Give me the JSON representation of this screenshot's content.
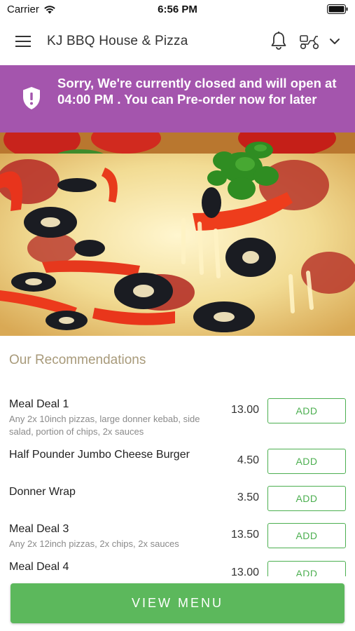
{
  "status_bar": {
    "carrier": "Carrier",
    "time": "6:56 PM"
  },
  "header": {
    "title": "KJ BBQ House & Pizza",
    "icons": [
      "menu-icon",
      "bell-icon",
      "scooter-icon",
      "chevron-down-icon"
    ]
  },
  "banner": {
    "message": "Sorry, We're currently closed and will open at 04:00 PM . You can Pre-order now for later",
    "color": "#a455ad",
    "icon": "shield-icon"
  },
  "recommendations": {
    "title": "Our Recommendations",
    "add_label": "ADD",
    "items": [
      {
        "name": "Meal Deal 1",
        "description": "Any 2x 10inch pizzas, large donner kebab, side salad, portion of chips, 2x sauces",
        "price": "13.00"
      },
      {
        "name": "Half Pounder Jumbo Cheese Burger",
        "description": "",
        "price": "4.50"
      },
      {
        "name": "Donner Wrap",
        "description": "",
        "price": "3.50"
      },
      {
        "name": "Meal Deal 3",
        "description": "Any 2x 12inch pizzas, 2x chips, 2x sauces",
        "price": "13.50"
      },
      {
        "name": "Meal Deal 4",
        "description": "",
        "price": "13.00"
      }
    ]
  },
  "footer": {
    "view_menu_label": "VIEW MENU",
    "color": "#5cb85c"
  },
  "colors": {
    "accent_green": "#4caf50",
    "banner_purple": "#a455ad",
    "section_title": "#a89a7a"
  }
}
